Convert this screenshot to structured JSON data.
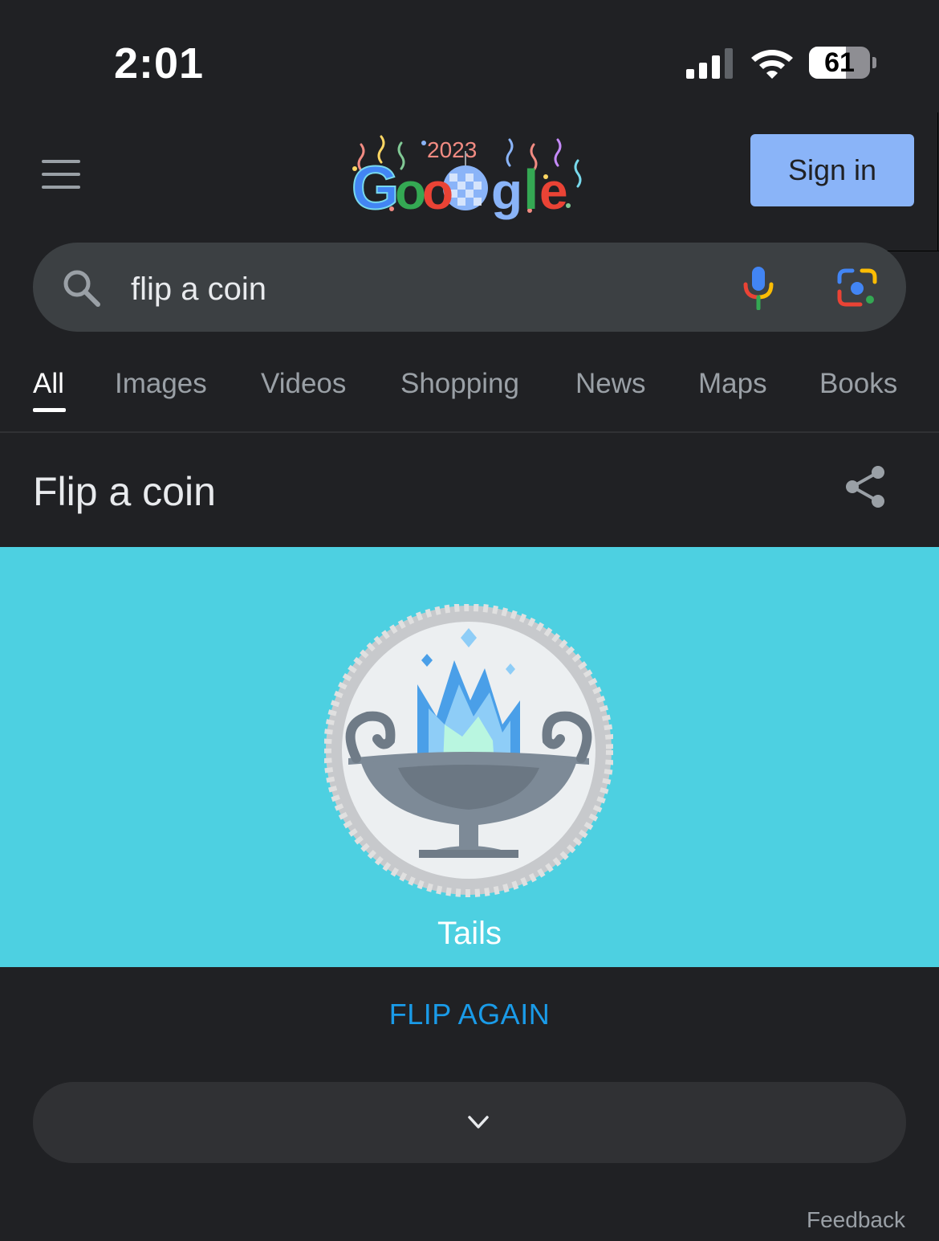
{
  "status_bar": {
    "time": "2:01",
    "battery_level": "61",
    "battery_fraction": 0.61
  },
  "header": {
    "menu_icon": "hamburger-menu-icon",
    "logo_text": "Google",
    "doodle_year": "2023",
    "sign_in_label": "Sign in"
  },
  "search": {
    "query": "flip a coin",
    "search_icon": "search-icon",
    "voice_icon": "mic-icon",
    "lens_icon": "google-lens-icon"
  },
  "tabs": [
    {
      "label": "All",
      "active": true
    },
    {
      "label": "Images",
      "active": false
    },
    {
      "label": "Videos",
      "active": false
    },
    {
      "label": "Shopping",
      "active": false
    },
    {
      "label": "News",
      "active": false
    },
    {
      "label": "Maps",
      "active": false
    },
    {
      "label": "Books",
      "active": false
    }
  ],
  "card": {
    "title": "Flip a coin",
    "share_icon": "share-icon",
    "result": "Tails",
    "flip_again_label": "FLIP AGAIN",
    "expand_icon": "chevron-down-icon",
    "panel_color": "#4dd0e1"
  },
  "footer": {
    "feedback_label": "Feedback"
  },
  "colors": {
    "background": "#202124",
    "accent_blue": "#8ab4f8",
    "link_blue": "#1a9be8"
  }
}
